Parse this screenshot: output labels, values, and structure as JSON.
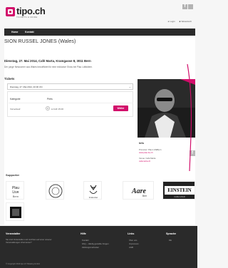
{
  "header": {
    "brand": "tipo.ch",
    "tagline": "TICKETS & MORE",
    "login": "Login",
    "cart": "Warenkorb"
  },
  "nav": {
    "items": [
      {
        "label": "Home"
      },
      {
        "label": "Kontakt"
      }
    ]
  },
  "event": {
    "title": "SION RUSSEL JONES (Wales)",
    "line": "Dienstag, 27. Mai 2014, Café Marta, Kramgasse 8, 3011 Bern",
    "note": "Der junge Newcomer aus Wales bezuftfäret für eine exklusive Show bei Plau Läfiddiern."
  },
  "tickets": {
    "label": "Tickets",
    "date_option": "Dienstag, 27. Mai 2014, 20:30 Uhr",
    "col_category": "Kategorie",
    "col_price": "Preis",
    "category": "Vorverkauf",
    "qty": "0",
    "price": "à CHF 15.00",
    "buy": "Weiter"
  },
  "info": {
    "title": "Info",
    "organizer": "Promoter: Plau LIVEBern",
    "organizer_link": "www.plau.be.ch",
    "venue": "Venue: Café Marta",
    "venue_link": "cafemarta.ch"
  },
  "supporters": {
    "label": "Supporter",
    "logos": [
      {
        "name": "Plau Live",
        "text": "Plau Live Bern"
      },
      {
        "name": "Seal",
        "text": ""
      },
      {
        "name": "Venue Bar",
        "text": "VENUE"
      },
      {
        "name": "Urban Bar",
        "text": "Usinabar"
      },
      {
        "name": "Aare Bier",
        "text": "Aare Bier"
      },
      {
        "name": "Einstein",
        "text": "EINSTEIN"
      },
      {
        "name": "Hotel",
        "text": ""
      }
    ]
  },
  "footer": {
    "col1_head": "Veranstalter",
    "col1_text": "Sie sind Veranstalter und möchten auf einer unserer Veranstaltungen informieren?",
    "col2_head": "Hilfe",
    "col2_items": [
      "Kontakt",
      "FAQ – Häufig gestellte Fragen",
      "Zahlungsmethoden"
    ],
    "col3_head": "Links",
    "col3_items": [
      "Über uns",
      "Impressum",
      "AGB"
    ],
    "col4_head": "Sprache",
    "col4_items": [
      "DE"
    ],
    "copyright": "© Copyright 2014 tipo.ch Ticketing GmbH"
  },
  "colors": {
    "accent": "#d20f6b",
    "nav_bg": "#2b2b2b",
    "footer_bg": "#2a2a2a"
  }
}
